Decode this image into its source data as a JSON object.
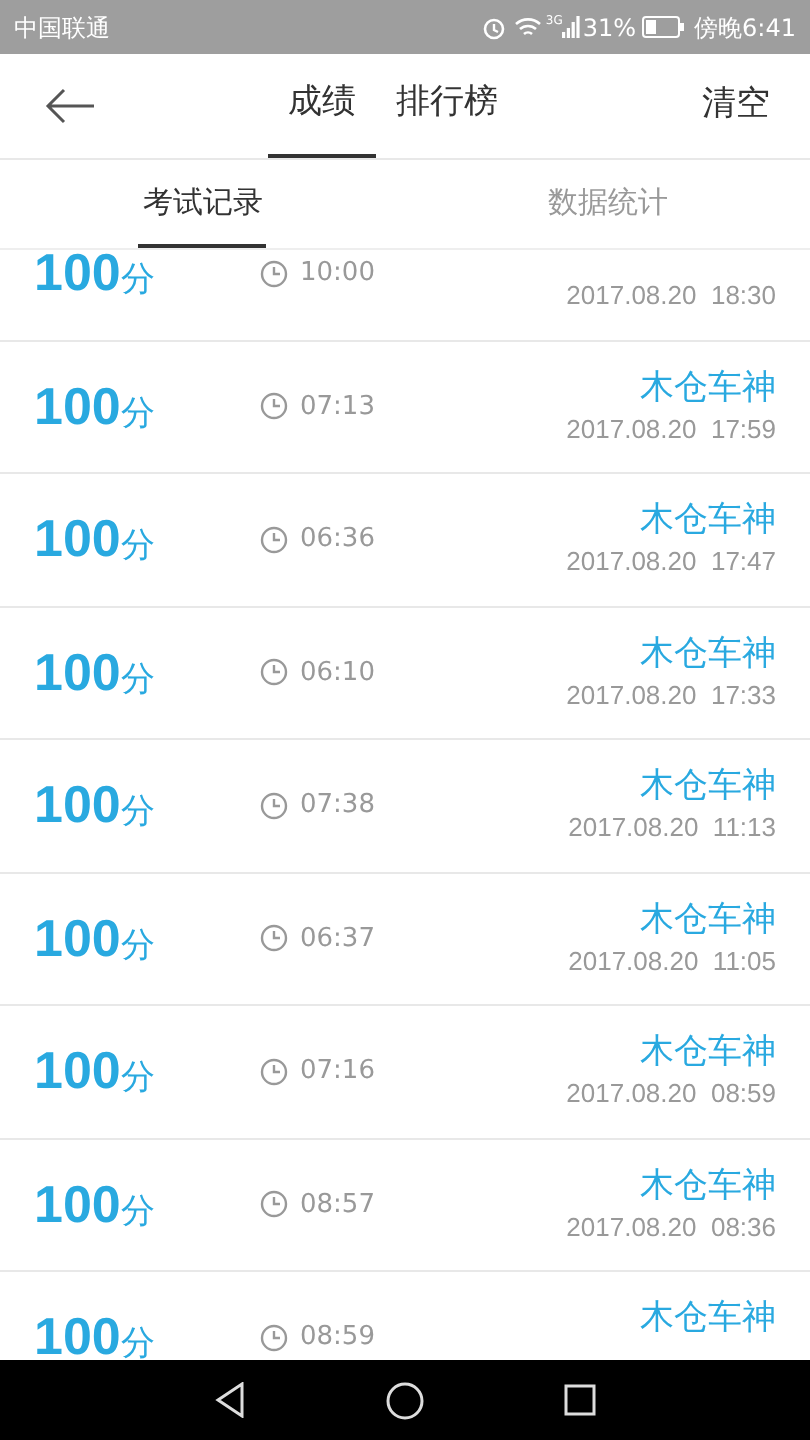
{
  "status_bar": {
    "carrier": "中国联通",
    "battery_text": "31%",
    "time": "傍晚6:41",
    "network": "3G"
  },
  "header": {
    "tabs": [
      {
        "label": "成绩",
        "selected": true
      },
      {
        "label": "排行榜",
        "selected": false
      }
    ],
    "action": "清空"
  },
  "sub_tabs": [
    {
      "label": "考试记录",
      "selected": true
    },
    {
      "label": "数据统计",
      "selected": false
    }
  ],
  "records": [
    {
      "score": "100",
      "unit": "分",
      "duration": "10:00",
      "date": "2017.08.20  18:30"
    },
    {
      "score": "100",
      "unit": "分",
      "duration": "07:13",
      "name": "木仓车神",
      "date": "2017.08.20  17:59"
    },
    {
      "score": "100",
      "unit": "分",
      "duration": "06:36",
      "name": "木仓车神",
      "date": "2017.08.20  17:47"
    },
    {
      "score": "100",
      "unit": "分",
      "duration": "06:10",
      "name": "木仓车神",
      "date": "2017.08.20  17:33"
    },
    {
      "score": "100",
      "unit": "分",
      "duration": "07:38",
      "name": "木仓车神",
      "date": "2017.08.20  11:13"
    },
    {
      "score": "100",
      "unit": "分",
      "duration": "06:37",
      "name": "木仓车神",
      "date": "2017.08.20  11:05"
    },
    {
      "score": "100",
      "unit": "分",
      "duration": "07:16",
      "name": "木仓车神",
      "date": "2017.08.20  08:59"
    },
    {
      "score": "100",
      "unit": "分",
      "duration": "08:57",
      "name": "木仓车神",
      "date": "2017.08.20  08:36"
    },
    {
      "score": "100",
      "unit": "分",
      "duration": "08:59",
      "name": "木仓车神"
    }
  ]
}
